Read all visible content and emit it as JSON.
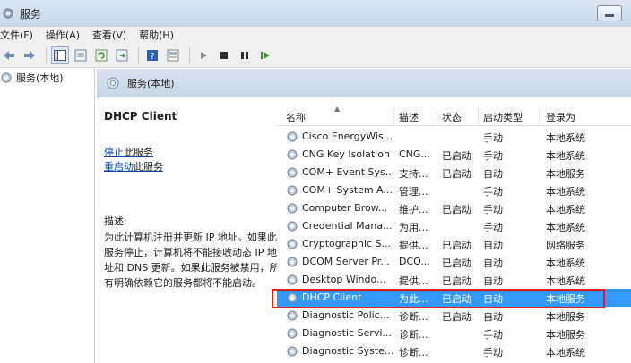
{
  "window": {
    "title": "服务"
  },
  "menu": [
    "文件(F)",
    "操作(A)",
    "查看(V)",
    "帮助(H)"
  ],
  "toolbar": {
    "icons": [
      "back-arrow-icon",
      "forward-arrow-icon",
      "console-tree-icon",
      "export-list-icon",
      "refresh-icon",
      "export-icon",
      "help-icon",
      "properties-icon",
      "start-icon",
      "stop-icon",
      "pause-icon",
      "restart-icon"
    ]
  },
  "tree": {
    "root_label": "服务(本地)"
  },
  "pane": {
    "header": "服务(本地)"
  },
  "details": {
    "service_name": "DHCP Client",
    "stop_link": "停止",
    "stop_suffix": "此服务",
    "restart_link": "重启动",
    "restart_suffix": "此服务",
    "desc_label": "描述:",
    "desc_text": "为此计算机注册并更新 IP 地址。如果此服务停止，计算机将不能接收动态 IP 地址和 DNS 更新。如果此服务被禁用，所有明确依赖它的服务都将不能启动。"
  },
  "list": {
    "columns": [
      "名称",
      "描述",
      "状态",
      "启动类型",
      "登录为"
    ],
    "rows": [
      {
        "name": "Cisco EnergyWis...",
        "desc": "",
        "status": "",
        "startup": "手动",
        "logon": "本地系统"
      },
      {
        "name": "CNG Key Isolation",
        "desc": "CNG...",
        "status": "已启动",
        "startup": "手动",
        "logon": "本地系统"
      },
      {
        "name": "COM+ Event Sys...",
        "desc": "支持...",
        "status": "已启动",
        "startup": "自动",
        "logon": "本地服务"
      },
      {
        "name": "COM+ System A...",
        "desc": "管理...",
        "status": "",
        "startup": "手动",
        "logon": "本地系统"
      },
      {
        "name": "Computer Brow...",
        "desc": "维护...",
        "status": "已启动",
        "startup": "手动",
        "logon": "本地系统"
      },
      {
        "name": "Credential Mana...",
        "desc": "为用...",
        "status": "",
        "startup": "手动",
        "logon": "本地系统"
      },
      {
        "name": "Cryptographic S...",
        "desc": "提供...",
        "status": "已启动",
        "startup": "自动",
        "logon": "网络服务"
      },
      {
        "name": "DCOM Server Pr...",
        "desc": "DCO...",
        "status": "已启动",
        "startup": "自动",
        "logon": "本地系统"
      },
      {
        "name": "Desktop Windo...",
        "desc": "提供...",
        "status": "已启动",
        "startup": "自动",
        "logon": "本地系统"
      },
      {
        "name": "DHCP Client",
        "desc": "为此...",
        "status": "已启动",
        "startup": "自动",
        "logon": "本地服务"
      },
      {
        "name": "Diagnostic Polic...",
        "desc": "诊断...",
        "status": "已启动",
        "startup": "自动",
        "logon": "本地服务"
      },
      {
        "name": "Diagnostic Servi...",
        "desc": "诊断...",
        "status": "",
        "startup": "手动",
        "logon": "本地服务"
      },
      {
        "name": "Diagnostic Syste...",
        "desc": "诊断...",
        "status": "",
        "startup": "手动",
        "logon": "本地系统"
      }
    ],
    "selected_index": 9
  },
  "colors": {
    "selection": "#3399ff",
    "highlight_border": "#e02020",
    "link": "#0645ad"
  }
}
